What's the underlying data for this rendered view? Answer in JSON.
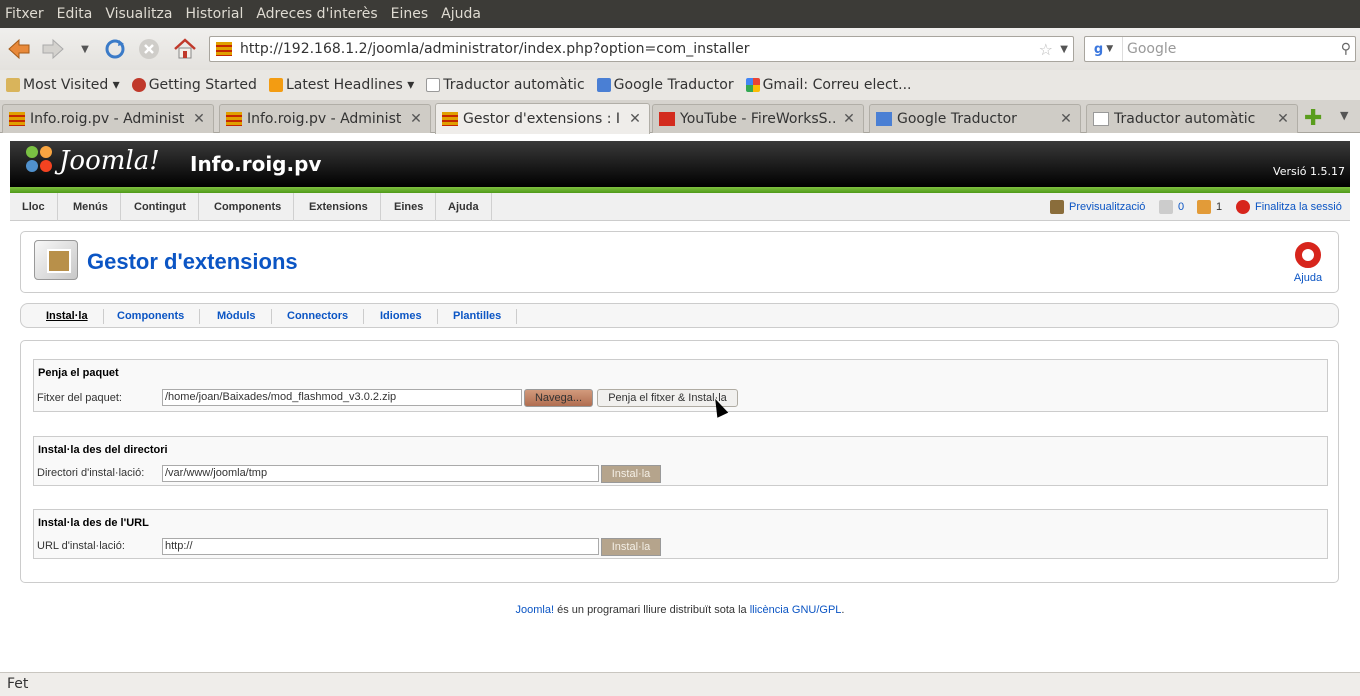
{
  "browser": {
    "menu": [
      "Fitxer",
      "Edita",
      "Visualitza",
      "Historial",
      "Adreces d'interès",
      "Eines",
      "Ajuda"
    ],
    "url": "http://192.168.1.2/joomla/administrator/index.php?option=com_installer",
    "search_placeholder": "Google",
    "bookmarks": [
      "Most Visited ▾",
      "Getting Started",
      "Latest Headlines ▾",
      "Traductor automàtic",
      "Google Traductor",
      "Gmail: Correu elect..."
    ],
    "tabs": [
      {
        "label": "Info.roig.pv - Administ...",
        "active": false
      },
      {
        "label": "Info.roig.pv - Administ...",
        "active": false
      },
      {
        "label": "Gestor d'extensions : I...",
        "active": true
      },
      {
        "label": "YouTube - FireWorksS...",
        "active": false
      },
      {
        "label": "Google Traductor",
        "active": false
      },
      {
        "label": "Traductor automàtic",
        "active": false
      }
    ],
    "status": "Fet"
  },
  "joomla": {
    "logo_text": "Joomla!",
    "site_name": "Info.roig.pv",
    "version": "Versió 1.5.17",
    "menu": [
      "Lloc",
      "Menús",
      "Contingut",
      "Components",
      "Extensions",
      "Eines",
      "Ajuda"
    ],
    "preview_label": "Previsualització",
    "messages_count": "0",
    "users_count": "1",
    "logout_label": "Finalitza la sessió",
    "page_title": "Gestor d'extensions",
    "help_label": "Ajuda",
    "submenu": [
      "Instal·la",
      "Components",
      "Mòduls",
      "Connectors",
      "Idiomes",
      "Plantilles"
    ],
    "upload": {
      "legend": "Penja el paquet",
      "label": "Fitxer del paquet:",
      "value": "/home/joan/Baixades/mod_flashmod_v3.0.2.zip",
      "browse_label": "Navega...",
      "submit_label": "Penja el fitxer & Instal·la"
    },
    "directory": {
      "legend": "Instal·la des del directori",
      "label": "Directori d'instal·lació:",
      "value": "/var/www/joomla/tmp",
      "submit_label": "Instal·la"
    },
    "url_install": {
      "legend": "Instal·la des de l'URL",
      "label": "URL d'instal·lació:",
      "value": "http://",
      "submit_label": "Instal·la"
    },
    "footer": {
      "link1": "Joomla!",
      "text": " és un programari lliure distribuït sota la ",
      "link2": "llicència GNU/GPL",
      "end": "."
    }
  }
}
